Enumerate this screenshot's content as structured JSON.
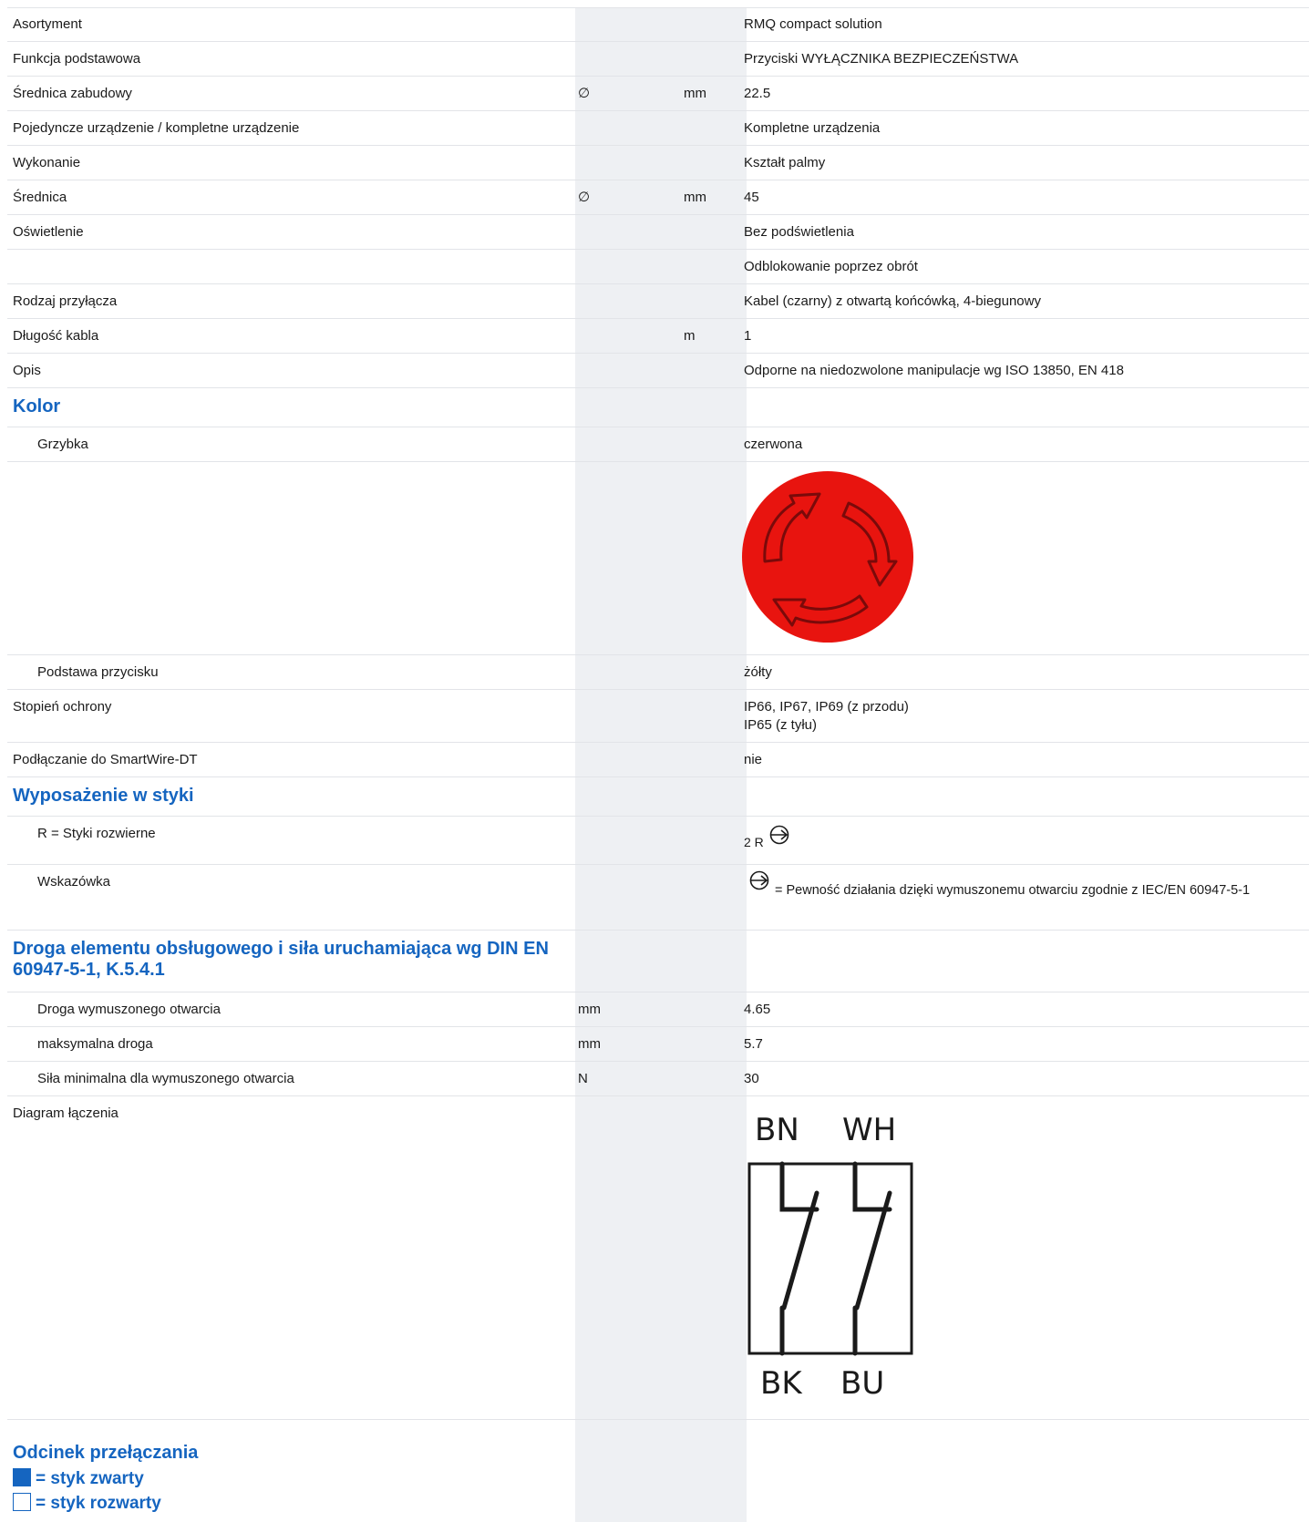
{
  "rows": [
    {
      "label": "Asortyment",
      "symbol": "",
      "unit": "",
      "value": "RMQ compact solution"
    },
    {
      "label": "Funkcja podstawowa",
      "symbol": "",
      "unit": "",
      "value": "Przyciski WYŁĄCZNIKA BEZPIECZEŃSTWA"
    },
    {
      "label": "Średnica zabudowy",
      "symbol": "∅",
      "unit": "mm",
      "value": "22.5"
    },
    {
      "label": "Pojedyncze urządzenie / kompletne urządzenie",
      "symbol": "",
      "unit": "",
      "value": "Kompletne urządzenia"
    },
    {
      "label": "Wykonanie",
      "symbol": "",
      "unit": "",
      "value": "Kształt palmy"
    },
    {
      "label": "Średnica",
      "symbol": "∅",
      "unit": "mm",
      "value": "45"
    },
    {
      "label": "Oświetlenie",
      "symbol": "",
      "unit": "",
      "value": "Bez podświetlenia"
    },
    {
      "label": "",
      "symbol": "",
      "unit": "",
      "value": "Odblokowanie poprzez obrót"
    },
    {
      "label": "Rodzaj przyłącza",
      "symbol": "",
      "unit": "",
      "value": "Kabel (czarny) z otwartą końcówką, 4-biegunowy"
    },
    {
      "label": "Długość kabla",
      "symbol": "",
      "unit": "m",
      "value": "1"
    },
    {
      "label": "Opis",
      "symbol": "",
      "unit": "",
      "value": "Odporne na niedozwolone manipulacje wg ISO 13850, EN 418"
    }
  ],
  "kolor": {
    "heading": "Kolor",
    "grzybka_label": "Grzybka",
    "grzybka_value": "czerwona",
    "button_color": "#e8140f",
    "podstawa_label": "Podstawa przycisku",
    "podstawa_value": "żółty"
  },
  "stopien": {
    "label": "Stopień ochrony",
    "value1": "IP66, IP67, IP69 (z przodu)",
    "value2": "IP65 (z tyłu)"
  },
  "smartwire": {
    "label": "Podłączanie do SmartWire-DT",
    "value": "nie"
  },
  "wyposazenie": {
    "heading": "Wyposażenie w styki",
    "styki_label": "R = Styki rozwierne",
    "styki_value": "2 R",
    "wskazowka_label": "Wskazówka",
    "wskazowka_value": "= Pewność działania dzięki wymuszonemu otwarciu zgodnie z IEC/EN 60947-5-1"
  },
  "droga": {
    "heading": "Droga elementu obsługowego i siła uruchamiająca wg DIN EN 60947-5-1, K.5.4.1",
    "rows": [
      {
        "label": "Droga wymuszonego otwarcia",
        "unit": "mm",
        "value": "4.65"
      },
      {
        "label": "maksymalna droga",
        "unit": "mm",
        "value": "5.7"
      },
      {
        "label": "Siła minimalna dla wymuszonego otwarcia",
        "unit": "N",
        "value": "30"
      }
    ]
  },
  "diagram": {
    "label": "Diagram łączenia",
    "top_left": "BN",
    "top_right": "WH",
    "bottom_left": "BK",
    "bottom_right": "BU"
  },
  "odcinek": {
    "heading": "Odcinek przełączania",
    "closed": "= styk zwarty",
    "open": "= styk rozwarty"
  },
  "colors": {
    "accent": "#1565c0",
    "shade": "#eef0f3",
    "divider": "#e2e4e8"
  }
}
